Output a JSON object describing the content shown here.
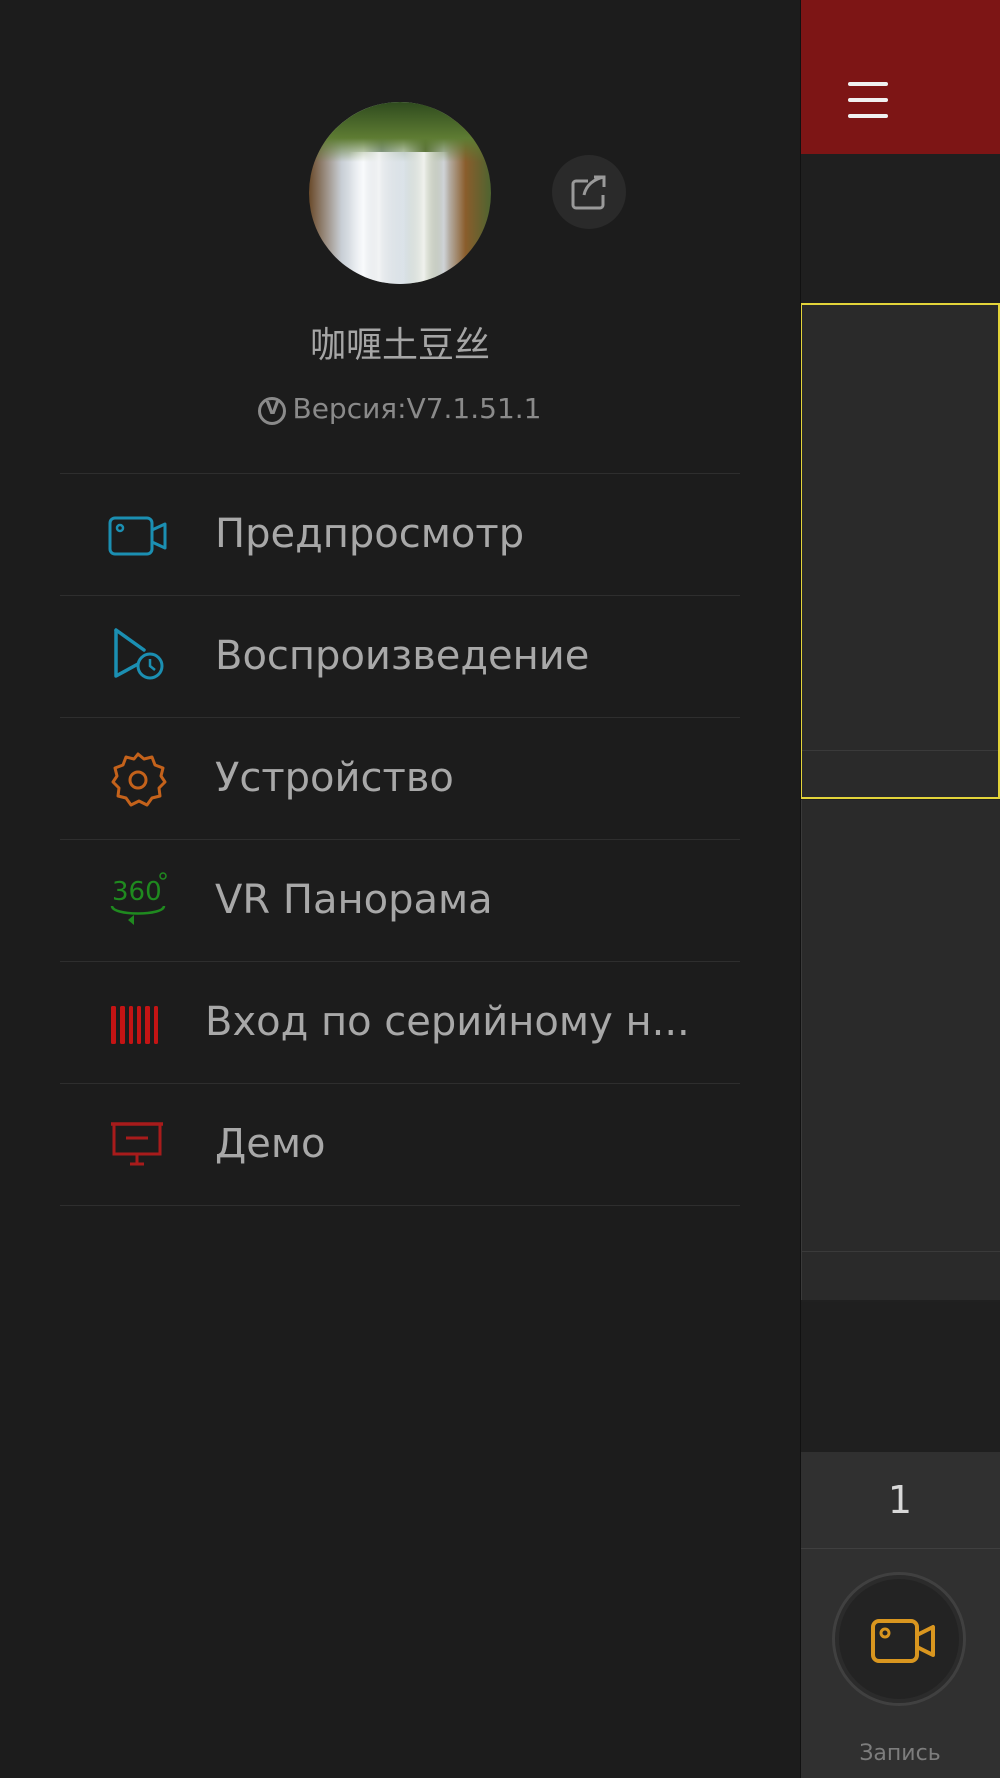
{
  "drawer": {
    "username": "咖喱土豆丝",
    "version": "Версия:V7.1.51.1",
    "menu": [
      {
        "label": "Предпросмотр",
        "icon": "camera-icon",
        "color": "#1b8fb2"
      },
      {
        "label": "Воспроизведение",
        "icon": "playback-clock-icon",
        "color": "#1b8fb2"
      },
      {
        "label": "Устройство",
        "icon": "gear-icon",
        "color": "#c4621b"
      },
      {
        "label": "VR Панорама",
        "icon": "vr-360-icon",
        "color": "#1f8a1f"
      },
      {
        "label": "Вход по серийному н...",
        "icon": "barcode-icon",
        "color": "#c41414"
      },
      {
        "label": "Демо",
        "icon": "presentation-icon",
        "color": "#a81b1b"
      }
    ]
  },
  "background_app": {
    "page_number": "1",
    "record_label": "Запись",
    "accent": "#7d1515",
    "selected_border": "#e3d43a",
    "record_icon_color": "#d9961f"
  }
}
